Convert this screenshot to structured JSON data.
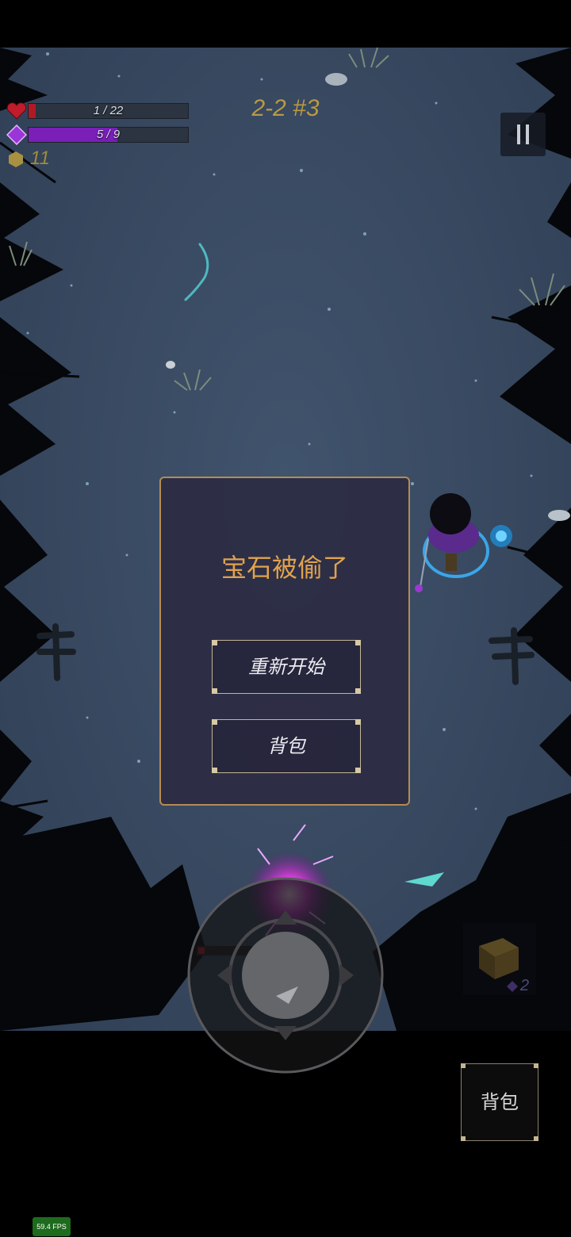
{
  "hud": {
    "health": {
      "current": 1,
      "max": 22,
      "text": "1 / 22",
      "fill_fraction": 0.045,
      "color": "#b01a24"
    },
    "mana": {
      "current": 5,
      "max": 9,
      "text": "5 / 9",
      "fill_fraction": 0.556,
      "color": "#7a1fb8"
    },
    "coins": "11",
    "stage": "2-2 #3"
  },
  "dialog": {
    "title": "宝石被偷了",
    "restart_label": "重新开始",
    "bag_label": "背包"
  },
  "bag_button": {
    "label": "背包"
  },
  "item_slot": {
    "count": "2"
  },
  "fps": "59.4 FPS",
  "colors": {
    "ground": "#3a4c64",
    "dialog_border": "#b48c52",
    "title": "#e0a24e"
  },
  "icons": [
    "heart-icon",
    "gem-icon",
    "coin-icon",
    "pause-icon",
    "cube-icon",
    "joystick"
  ]
}
